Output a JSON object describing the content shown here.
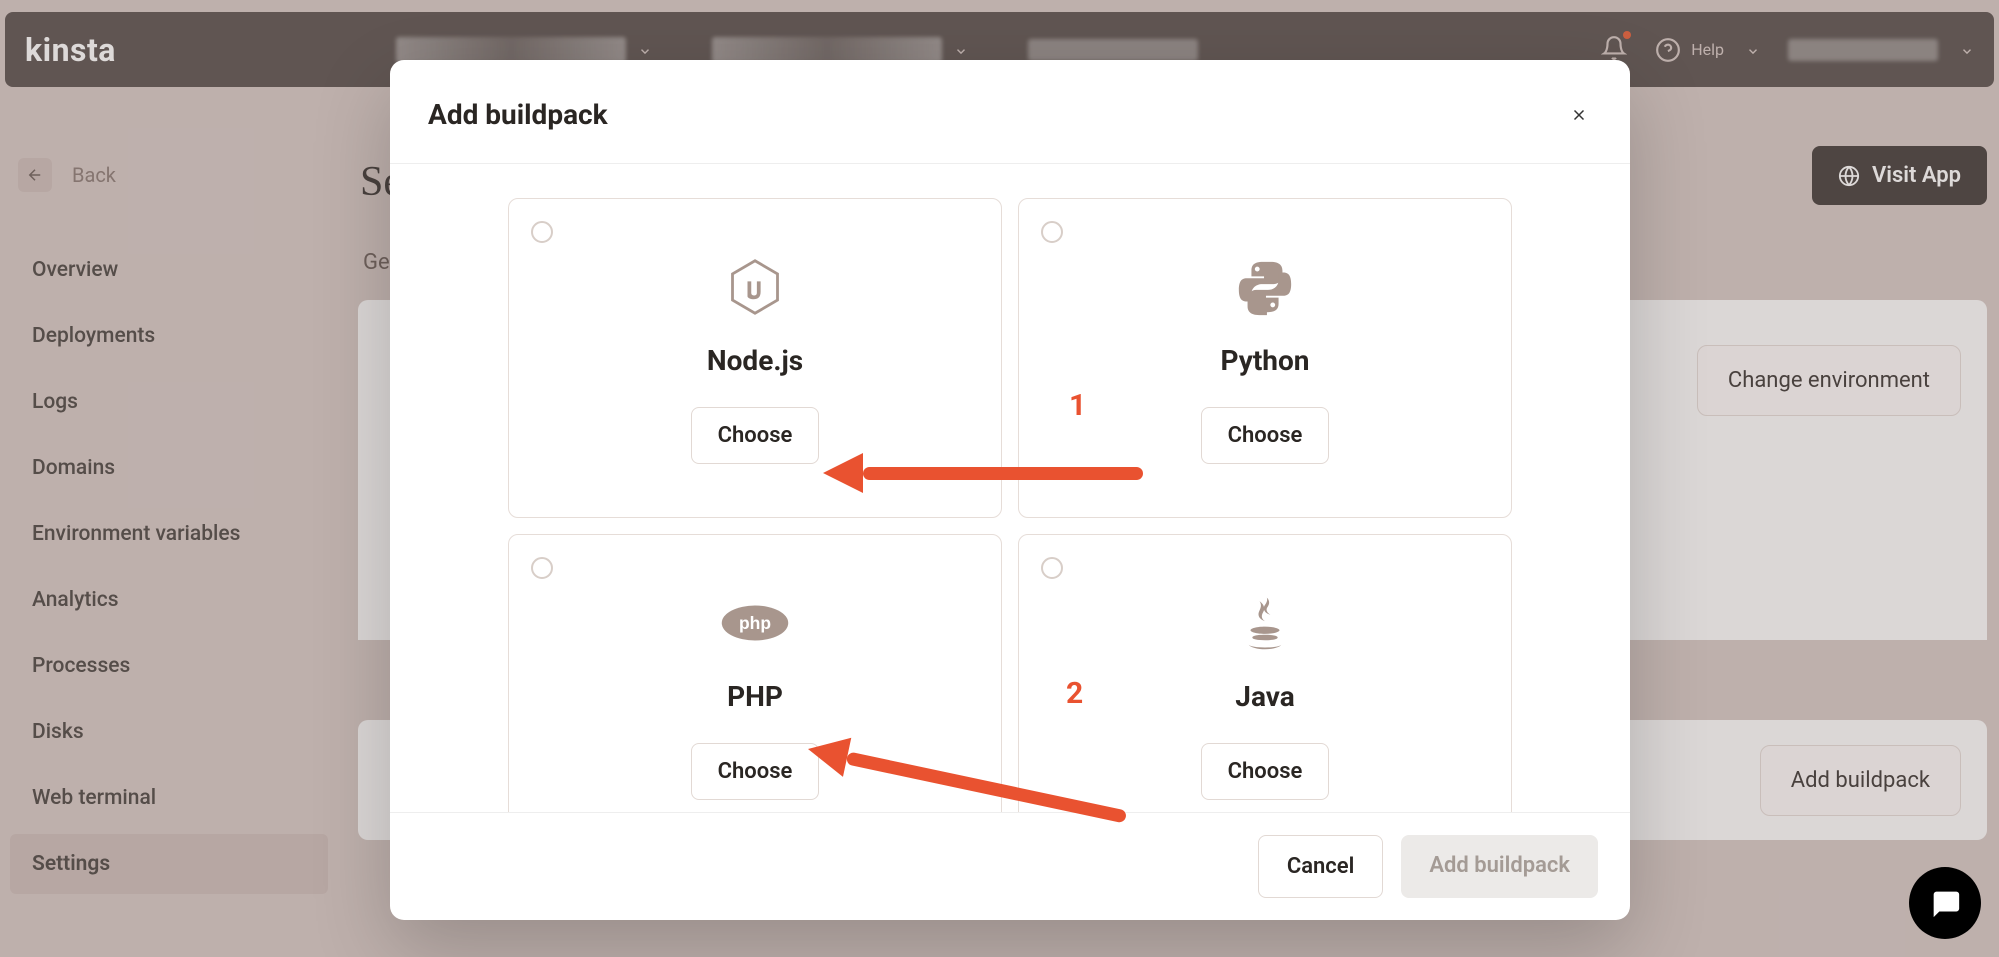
{
  "brand": "kinsta",
  "topbar": {
    "help_label": "Help"
  },
  "back_label": "Back",
  "nav_items": [
    "Overview",
    "Deployments",
    "Logs",
    "Domains",
    "Environment variables",
    "Analytics",
    "Processes",
    "Disks",
    "Web terminal",
    "Settings"
  ],
  "nav_active_index": 9,
  "page_title": "Se",
  "general_tab": "Ge",
  "change_env_label": "Change environment",
  "add_bp_side_label": "Add buildpack",
  "visit_app_label": "Visit App",
  "modal": {
    "title": "Add buildpack",
    "cancel": "Cancel",
    "confirm": "Add buildpack",
    "buildpacks": [
      {
        "name": "Node.js",
        "icon": "nodejs",
        "choose": "Choose"
      },
      {
        "name": "Python",
        "icon": "python",
        "choose": "Choose"
      },
      {
        "name": "PHP",
        "icon": "php",
        "choose": "Choose"
      },
      {
        "name": "Java",
        "icon": "java",
        "choose": "Choose"
      }
    ]
  },
  "annotations": {
    "one": "1",
    "two": "2"
  }
}
